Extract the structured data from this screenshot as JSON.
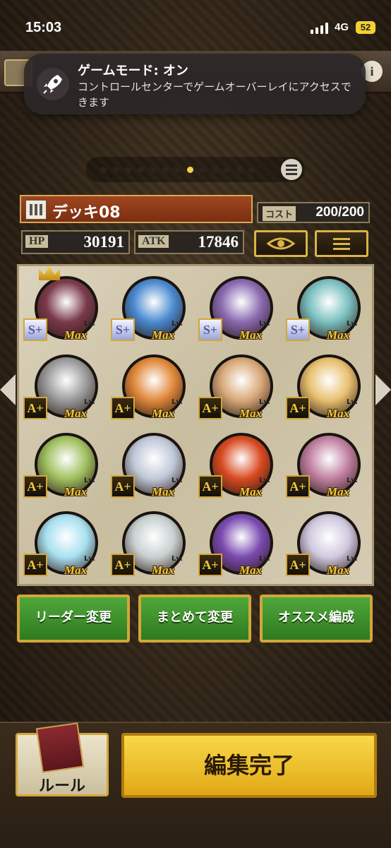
{
  "status_bar": {
    "time": "15:03",
    "network": "4G",
    "battery": "52"
  },
  "notification": {
    "title": "ゲームモード: オン",
    "body": "コントロールセンターでゲームオーバーレイにアクセスできます",
    "icon": "rocket-icon"
  },
  "top_bar": {
    "info_label": "i"
  },
  "pager": {
    "total": 13,
    "active_index": 7
  },
  "deck": {
    "name": "デッキ08",
    "cost_label": "コスト",
    "cost_value": "200/200",
    "hp_label": "HP",
    "hp_value": "30191",
    "atk_label": "ATK",
    "atk_value": "17846"
  },
  "cards": [
    {
      "rank": "S+",
      "rank_class": "s",
      "lv_label": "Lv.",
      "level": "Max",
      "color": "#7a3a4a",
      "leader": true
    },
    {
      "rank": "S+",
      "rank_class": "s",
      "lv_label": "Lv.",
      "level": "Max",
      "color": "#4a8ad0"
    },
    {
      "rank": "S+",
      "rank_class": "s",
      "lv_label": "Lv.",
      "level": "Max",
      "color": "#8a6ab0"
    },
    {
      "rank": "S+",
      "rank_class": "s",
      "lv_label": "Lv.",
      "level": "Max",
      "color": "#7ac0c0"
    },
    {
      "rank": "A+",
      "rank_class": "a",
      "lv_label": "Lv.",
      "level": "Max",
      "color": "#9a9a9a"
    },
    {
      "rank": "A+",
      "rank_class": "a",
      "lv_label": "Lv.",
      "level": "Max",
      "color": "#e0883a"
    },
    {
      "rank": "A+",
      "rank_class": "a",
      "lv_label": "Lv.",
      "level": "Max",
      "color": "#d8a878"
    },
    {
      "rank": "A+",
      "rank_class": "a",
      "lv_label": "Lv.",
      "level": "Max",
      "color": "#e8c070"
    },
    {
      "rank": "A+",
      "rank_class": "a",
      "lv_label": "Lv.",
      "level": "Max",
      "color": "#a0c060"
    },
    {
      "rank": "A+",
      "rank_class": "a",
      "lv_label": "Lv.",
      "level": "Max",
      "color": "#c0c8d8"
    },
    {
      "rank": "A+",
      "rank_class": "a",
      "lv_label": "Lv.",
      "level": "Max",
      "color": "#d84a20"
    },
    {
      "rank": "A+",
      "rank_class": "a",
      "lv_label": "Lv.",
      "level": "Max",
      "color": "#c080a0"
    },
    {
      "rank": "A+",
      "rank_class": "a",
      "lv_label": "Lv.",
      "level": "Max",
      "color": "#a8e0f0"
    },
    {
      "rank": "A+",
      "rank_class": "a",
      "lv_label": "Lv.",
      "level": "Max",
      "color": "#c8d0d0"
    },
    {
      "rank": "A+",
      "rank_class": "a",
      "lv_label": "Lv.",
      "level": "Max",
      "color": "#7a4ab0"
    },
    {
      "rank": "A+",
      "rank_class": "a",
      "lv_label": "Lv.",
      "level": "Max",
      "color": "#d0c8e0"
    }
  ],
  "actions": {
    "leader_change": "リーダー変更",
    "bulk_change": "まとめて変更",
    "recommended": "オススメ編成"
  },
  "bottom": {
    "rule_label": "ルール",
    "done_label": "編集完了"
  }
}
